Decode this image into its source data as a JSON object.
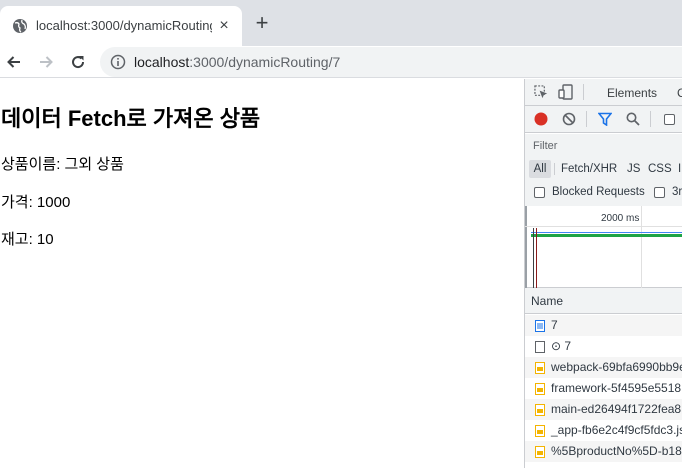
{
  "browser": {
    "tab_title": "localhost:3000/dynamicRouting/7",
    "tab_close": "×",
    "new_tab": "+",
    "url_host": "localhost",
    "url_path": ":3000/dynamicRouting/7"
  },
  "page": {
    "heading": "데이터 Fetch로 가져온 상품",
    "name_line": "상품이름: 그외 상품",
    "price_line": "가격: 1000",
    "stock_line": "재고: 10"
  },
  "devtools": {
    "tab_elements": "Elements",
    "tab_console_partial": "C",
    "filter_label": "Filter",
    "types": [
      "All",
      "Fetch/XHR",
      "JS",
      "CSS",
      "Ir"
    ],
    "blocked_requests": "Blocked Requests",
    "third_party_partial": "3r",
    "overview_tick": "2000 ms",
    "name_column": "Name",
    "requests": [
      "7",
      "⊙ 7",
      "webpack-69bfa6990bb9e",
      "framework-5f4595e5518",
      "main-ed26494f1722fea8",
      "_app-fb6e2c4f9cf5fdc3.js",
      "%5BproductNo%5D-b18"
    ],
    "colors": {
      "record": "#d93025",
      "filter_active": "#1a73e8",
      "doc_icon": "#1a73e8",
      "js_icon": "#f4b400"
    }
  }
}
